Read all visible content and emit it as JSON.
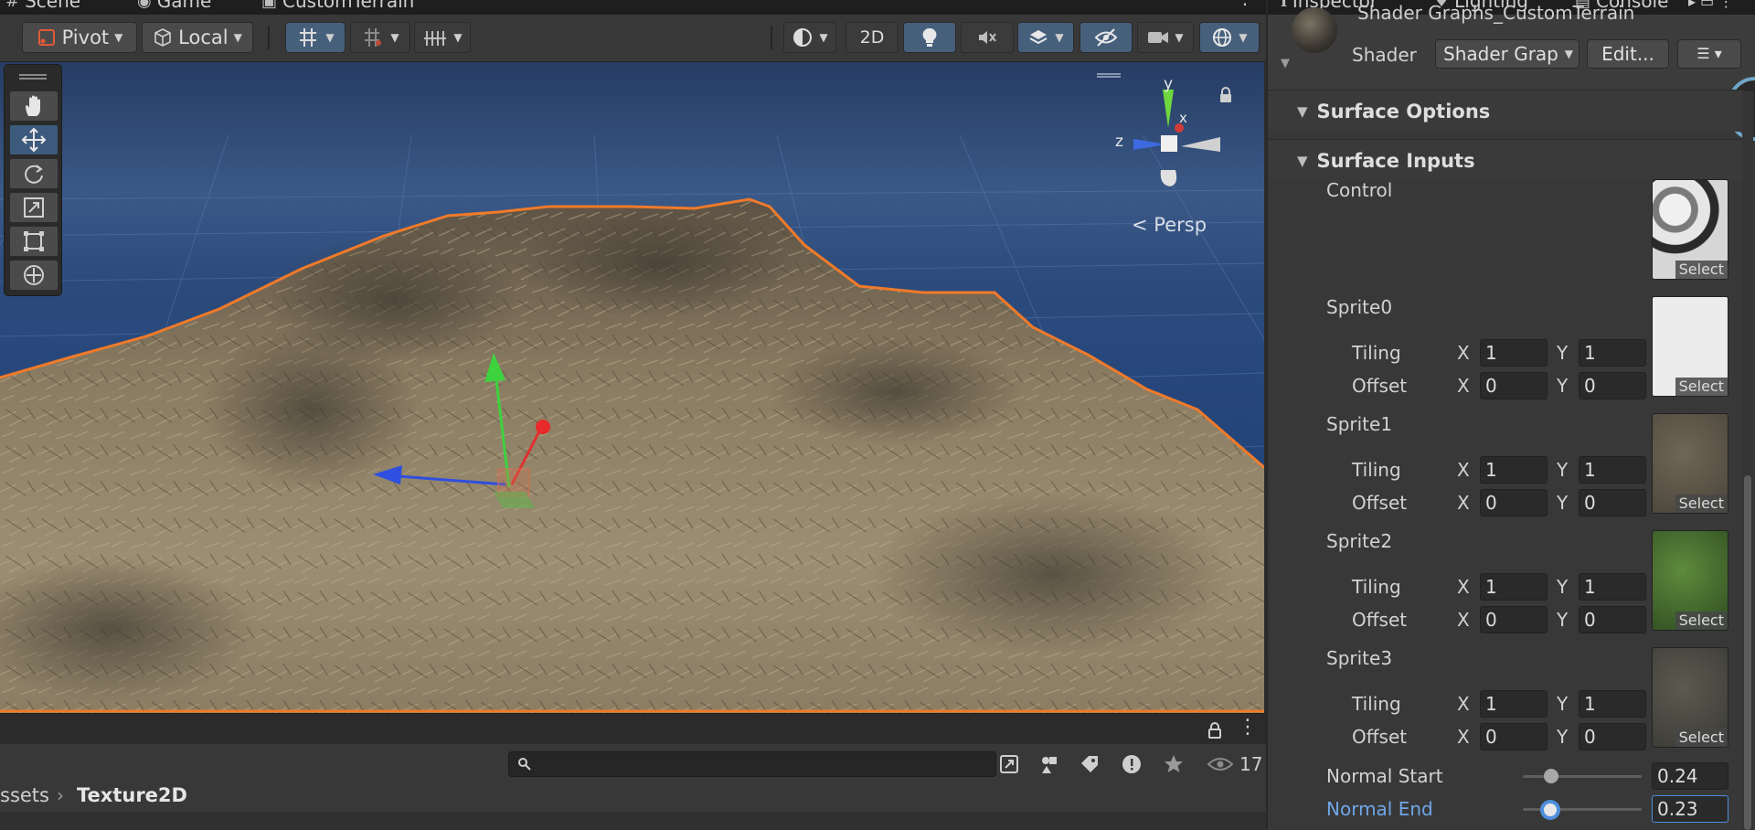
{
  "scene_tabs": [
    {
      "label": "Scene",
      "icon": "hash-icon"
    },
    {
      "label": "Game",
      "icon": "gamepad-icon"
    },
    {
      "label": "CustomTerrain",
      "icon": "terrain-icon"
    }
  ],
  "toolbar": {
    "pivot_label": "Pivot",
    "local_label": "Local",
    "mode_2d_label": "2D"
  },
  "viewport": {
    "projection_label": "Persp",
    "gizmo_axes": {
      "y": "y",
      "x": "x",
      "z": "z"
    }
  },
  "project": {
    "search_placeholder": "",
    "hidden_count": "17",
    "breadcrumb": [
      "ssets",
      "Texture2D"
    ]
  },
  "inspector": {
    "tabs": [
      {
        "label": "Inspector",
        "icon": "info-icon"
      },
      {
        "label": "Lighting",
        "icon": "bulb-icon"
      },
      {
        "label": "Console",
        "icon": "console-icon"
      }
    ],
    "material_name": "Shader Graphs_CustomTerrain",
    "shader_label": "Shader",
    "shader_value": "Shader Grap",
    "edit_label": "Edit...",
    "sections": {
      "surface_options": "Surface Options",
      "surface_inputs": "Surface Inputs"
    },
    "control": {
      "label": "Control",
      "select_label": "Select"
    },
    "sprites": [
      {
        "label": "Sprite0",
        "tiling_label": "Tiling",
        "offset_label": "Offset",
        "tiling": {
          "x": "1",
          "y": "1"
        },
        "offset": {
          "x": "0",
          "y": "0"
        },
        "select_label": "Select",
        "swatch": "#e8e8e8"
      },
      {
        "label": "Sprite1",
        "tiling_label": "Tiling",
        "offset_label": "Offset",
        "tiling": {
          "x": "1",
          "y": "1"
        },
        "offset": {
          "x": "0",
          "y": "0"
        },
        "select_label": "Select",
        "swatch": "#5b5448"
      },
      {
        "label": "Sprite2",
        "tiling_label": "Tiling",
        "offset_label": "Offset",
        "tiling": {
          "x": "1",
          "y": "1"
        },
        "offset": {
          "x": "0",
          "y": "0"
        },
        "select_label": "Select",
        "swatch": "#3f6a2c"
      },
      {
        "label": "Sprite3",
        "tiling_label": "Tiling",
        "offset_label": "Offset",
        "tiling": {
          "x": "1",
          "y": "1"
        },
        "offset": {
          "x": "0",
          "y": "0"
        },
        "select_label": "Select",
        "swatch": "#4a4a42"
      }
    ],
    "axis_labels": {
      "x": "X",
      "y": "Y"
    },
    "normal_start": {
      "label": "Normal Start",
      "value": "0.24",
      "level": 0.24
    },
    "normal_end": {
      "label": "Normal End",
      "value": "0.23",
      "level": 0.23
    }
  },
  "colors": {
    "selection_outline": "#f07a2a",
    "accent_blue": "#4d8fdc",
    "active_button": "#46607c"
  }
}
